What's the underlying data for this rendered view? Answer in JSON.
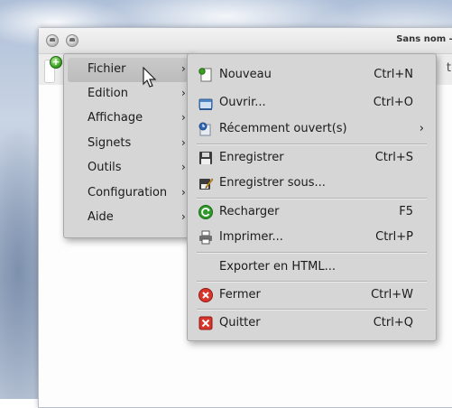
{
  "window": {
    "title": "Sans nom - K",
    "toolbar_partial_text": "tre"
  },
  "menubar": {
    "items": [
      {
        "label": "Fichier",
        "arrow": "›"
      },
      {
        "label": "Edition",
        "arrow": "›"
      },
      {
        "label": "Affichage",
        "arrow": "›"
      },
      {
        "label": "Signets",
        "arrow": "›"
      },
      {
        "label": "Outils",
        "arrow": "›"
      },
      {
        "label": "Configuration",
        "arrow": "›"
      },
      {
        "label": "Aide",
        "arrow": "›"
      }
    ]
  },
  "fichier_menu": {
    "items": [
      {
        "label": "Nouveau",
        "shortcut": "Ctrl+N",
        "icon": "new-document-icon"
      },
      {
        "label": "Ouvrir...",
        "shortcut": "Ctrl+O",
        "icon": "open-folder-icon"
      },
      {
        "label": "Récemment ouvert(s)",
        "shortcut": "",
        "submenu_arrow": "›",
        "icon": "recent-files-icon"
      },
      {
        "label": "Enregistrer",
        "shortcut": "Ctrl+S",
        "icon": "save-icon"
      },
      {
        "label": "Enregistrer sous...",
        "shortcut": "",
        "icon": "save-as-icon"
      },
      {
        "label": "Recharger",
        "shortcut": "F5",
        "icon": "reload-icon"
      },
      {
        "label": "Imprimer...",
        "shortcut": "Ctrl+P",
        "icon": "print-icon"
      },
      {
        "label": "Exporter en HTML...",
        "shortcut": "",
        "icon": ""
      },
      {
        "label": "Fermer",
        "shortcut": "Ctrl+W",
        "icon": "close-document-icon"
      },
      {
        "label": "Quitter",
        "shortcut": "Ctrl+Q",
        "icon": "quit-icon"
      }
    ]
  },
  "colors": {
    "menu_bg": "#d6d6d6",
    "highlight": "#bcbcbc",
    "quit_red": "#d9342b",
    "reload_green": "#2e9a2a"
  }
}
